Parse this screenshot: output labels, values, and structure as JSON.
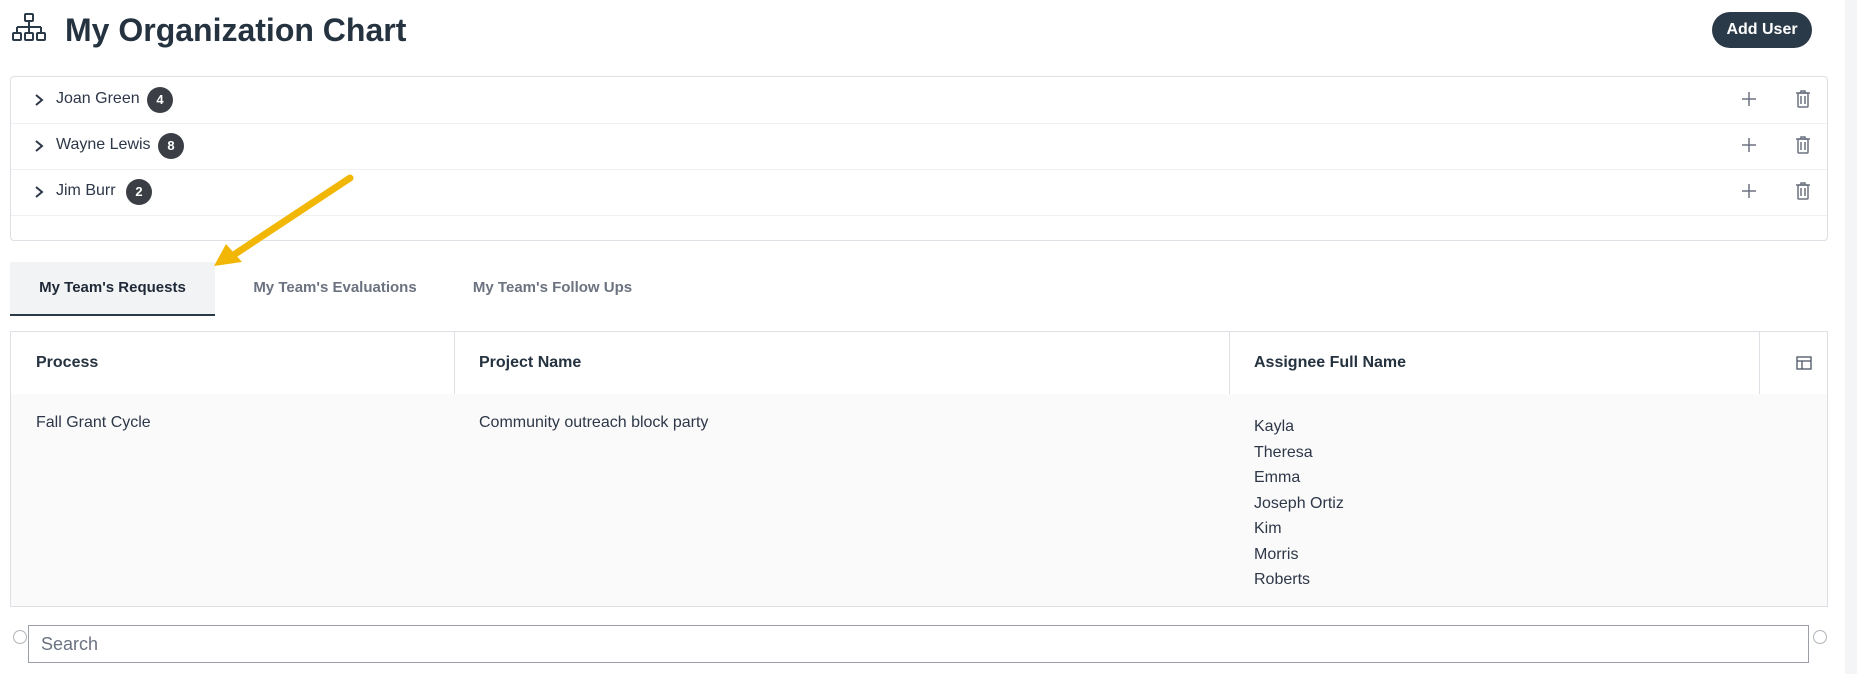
{
  "header": {
    "title": "My Organization Chart",
    "add_user_label": "Add User"
  },
  "org_tree": {
    "users": [
      {
        "name": "Joan Green",
        "count": "4"
      },
      {
        "name": "Wayne Lewis",
        "count": "8"
      },
      {
        "name": "Jim Burr",
        "count": "2"
      }
    ]
  },
  "tabs": [
    {
      "label": "My Team's Requests",
      "active": true
    },
    {
      "label": "My Team's Evaluations",
      "active": false
    },
    {
      "label": "My Team's Follow Ups",
      "active": false
    }
  ],
  "table": {
    "columns": [
      "Process",
      "Project Name",
      "Assignee Full Name"
    ],
    "rows": [
      {
        "process": "Fall Grant Cycle",
        "project": "Community outreach block party",
        "assignees": [
          "Kayla",
          "Theresa",
          "Emma",
          "Joseph Ortiz",
          "Kim",
          "Morris",
          "Roberts"
        ]
      }
    ]
  },
  "search": {
    "placeholder": "Search"
  },
  "colors": {
    "accent": "#2b3a48",
    "badge": "#3b3f45",
    "arrow": "#f2b705"
  },
  "icons": [
    "org-chart-icon",
    "chevron-right-icon",
    "plus-icon",
    "trash-icon",
    "table-columns-icon"
  ]
}
